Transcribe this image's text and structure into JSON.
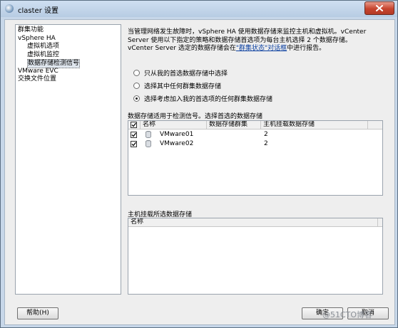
{
  "window": {
    "title": "claster 设置"
  },
  "sidebar": {
    "items": [
      {
        "label": "群集功能",
        "indent": 0
      },
      {
        "label": "vSphere HA",
        "indent": 0
      },
      {
        "label": "虚拟机选项",
        "indent": 1
      },
      {
        "label": "虚拟机监控",
        "indent": 1
      },
      {
        "label": "数据存储检测信号",
        "indent": 1,
        "selected": true
      },
      {
        "label": "VMware EVC",
        "indent": 0
      },
      {
        "label": "交换文件位置",
        "indent": 0
      }
    ]
  },
  "main": {
    "description": {
      "line1": "当管理网络发生故障时，vSphere HA 使用数据存储来监控主机和虚拟机。vCenter",
      "line2": "Server 使用以下指定的策略和数据存储首选项为每台主机选择 2 个数据存储。",
      "line3_before": "vCenter Server 选定的数据存储会在",
      "line3_link": "\"群集状态\"对话框",
      "line3_after": "中进行报告。"
    },
    "options": [
      {
        "label": "只从我的首选数据存储中选择",
        "checked": false
      },
      {
        "label": "选择其中任何群集数据存储",
        "checked": false
      },
      {
        "label": "选择考虑加入我的首选项的任何群集数据存储",
        "checked": true
      }
    ],
    "datastores": {
      "label": "数据存储适用于检测信号。选择首选的数据存储",
      "columns": {
        "name": "名称",
        "cluster": "数据存储群集",
        "hosts": "主机挂载数据存储"
      },
      "header_checked": true,
      "rows": [
        {
          "name": "VMware01",
          "cluster": "",
          "hosts": "2",
          "checked": true
        },
        {
          "name": "VMware02",
          "cluster": "",
          "hosts": "2",
          "checked": true
        }
      ]
    },
    "hosts_section": {
      "label": "主机挂载所选数据存储",
      "columns": {
        "name": "名称"
      }
    }
  },
  "footer": {
    "help_label": "帮助(H)",
    "ok_label": "确定",
    "cancel_label": "取消"
  },
  "watermark": "@51CTO博客"
}
